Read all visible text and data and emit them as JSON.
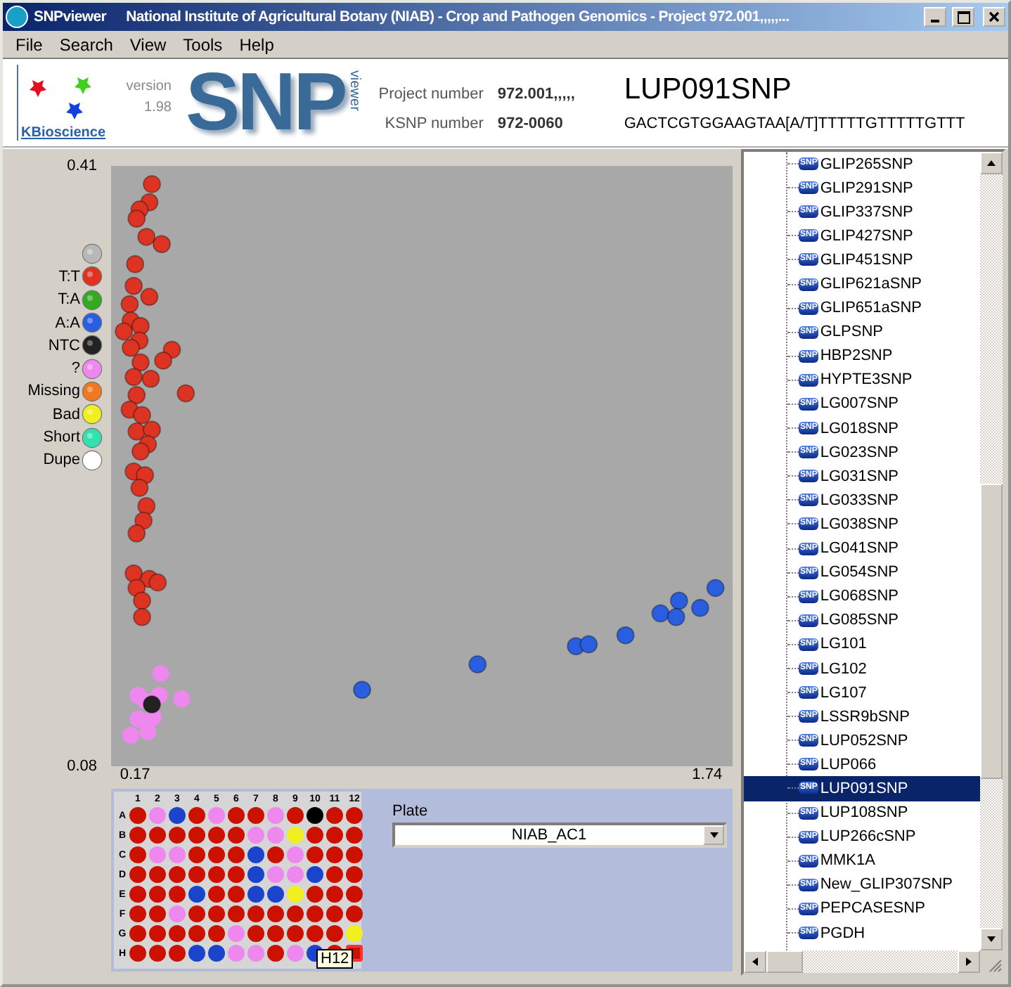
{
  "window": {
    "app_name": "SNPviewer",
    "title": "National Institute of Agricultural Botany (NIAB) - Crop and Pathogen Genomics - Project 972.001,,,,,..."
  },
  "menu": [
    "File",
    "Search",
    "View",
    "Tools",
    "Help"
  ],
  "header": {
    "company": "KBioscience",
    "version_label": "version",
    "version": "1.98",
    "logo_text": "SNP",
    "logo_sub": "viewer",
    "project_label": "Project number",
    "project_value": "972.001,,,,,",
    "ksnp_label": "KSNP number",
    "ksnp_value": "972-0060",
    "snp_name": "LUP091SNP",
    "sequence": "GACTCGTGGAAGTAA[A/T]TTTTTGTTTTTGTTT"
  },
  "legend": [
    {
      "color": "#b8b8b8"
    },
    {
      "label": "T:T",
      "color": "#dd3322"
    },
    {
      "label": "T:A",
      "color": "#33aa22"
    },
    {
      "label": "A:A",
      "color": "#2a5ee0"
    },
    {
      "label": "NTC",
      "color": "#222222"
    },
    {
      "label": "?",
      "color": "#ee88ee"
    },
    {
      "label": "Missing",
      "color": "#f07820"
    },
    {
      "label": "Bad",
      "color": "#f0f020"
    },
    {
      "label": "Short",
      "color": "#33e0b0"
    },
    {
      "label": "Dupe",
      "color": "#ffffff"
    }
  ],
  "plot": {
    "chart_data": {
      "type": "scatter",
      "xlim": [
        0.104,
        1.81
      ],
      "ylim": [
        0.08,
        0.41
      ],
      "xticks": [
        {
          "value": 0.17,
          "label": "0.17"
        },
        {
          "value": 1.74,
          "label": "1.74"
        }
      ],
      "yticks": [
        {
          "value": 0.08,
          "label": "0.08"
        },
        {
          "value": 0.41,
          "label": "0.41"
        }
      ],
      "series": [
        {
          "color": "#dd3322",
          "x": [
            0.216,
            0.209,
            0.182,
            0.174,
            0.201,
            0.243,
            0.17,
            0.166,
            0.209,
            0.155,
            0.158,
            0.185,
            0.139,
            0.182,
            0.271,
            0.247,
            0.158,
            0.185,
            0.166,
            0.213,
            0.309,
            0.174,
            0.155,
            0.189,
            0.174,
            0.216,
            0.205,
            0.185,
            0.166,
            0.197,
            0.182,
            0.201,
            0.193,
            0.174,
            0.166,
            0.209,
            0.232,
            0.174,
            0.189,
            0.189
          ],
          "values": [
            0.4,
            0.39,
            0.386,
            0.381,
            0.371,
            0.367,
            0.356,
            0.344,
            0.338,
            0.334,
            0.325,
            0.322,
            0.319,
            0.314,
            0.309,
            0.303,
            0.31,
            0.302,
            0.294,
            0.293,
            0.285,
            0.284,
            0.276,
            0.273,
            0.264,
            0.265,
            0.257,
            0.253,
            0.242,
            0.24,
            0.233,
            0.223,
            0.215,
            0.208,
            0.186,
            0.183,
            0.181,
            0.178,
            0.171,
            0.162
          ]
        },
        {
          "color": "#2a5ee0",
          "x": [
            0.793,
            1.11,
            1.38,
            1.415,
            1.516,
            1.612,
            1.663,
            1.655,
            1.721,
            1.763
          ],
          "values": [
            0.122,
            0.136,
            0.146,
            0.147,
            0.152,
            0.164,
            0.171,
            0.162,
            0.167,
            0.178
          ]
        },
        {
          "color": "#ee88ee",
          "x": [
            0.24,
            0.178,
            0.236,
            0.298,
            0.197,
            0.22,
            0.178,
            0.205,
            0.158
          ],
          "values": [
            0.131,
            0.119,
            0.119,
            0.117,
            0.116,
            0.107,
            0.106,
            0.099,
            0.097
          ]
        },
        {
          "color": "#222222",
          "x": [
            0.216
          ],
          "values": [
            0.114
          ]
        }
      ]
    }
  },
  "plate": {
    "columns": [
      "1",
      "2",
      "3",
      "4",
      "5",
      "6",
      "7",
      "8",
      "9",
      "10",
      "11",
      "12"
    ],
    "rows": [
      {
        "label": "A",
        "wells": [
          {
            "color": "#cc1100",
            "selected": false
          },
          {
            "color": "#ee88ee",
            "selected": false
          },
          {
            "color": "#1a44cc",
            "selected": false
          },
          {
            "color": "#cc1100",
            "selected": false
          },
          {
            "color": "#ee88ee",
            "selected": false
          },
          {
            "color": "#cc1100",
            "selected": false
          },
          {
            "color": "#cc1100",
            "selected": false
          },
          {
            "color": "#ee88ee",
            "selected": false
          },
          {
            "color": "#cc1100",
            "selected": false
          },
          {
            "color": "#000000",
            "selected": false
          },
          {
            "color": "#cc1100",
            "selected": false
          },
          {
            "color": "#cc1100",
            "selected": false
          }
        ]
      },
      {
        "label": "B",
        "wells": [
          {
            "color": "#cc1100",
            "selected": false
          },
          {
            "color": "#cc1100",
            "selected": false
          },
          {
            "color": "#cc1100",
            "selected": false
          },
          {
            "color": "#cc1100",
            "selected": false
          },
          {
            "color": "#cc1100",
            "selected": false
          },
          {
            "color": "#cc1100",
            "selected": false
          },
          {
            "color": "#ee88ee",
            "selected": false
          },
          {
            "color": "#ee88ee",
            "selected": false
          },
          {
            "color": "#f0f020",
            "selected": false
          },
          {
            "color": "#cc1100",
            "selected": false
          },
          {
            "color": "#cc1100",
            "selected": false
          },
          {
            "color": "#cc1100",
            "selected": false
          }
        ]
      },
      {
        "label": "C",
        "wells": [
          {
            "color": "#cc1100",
            "selected": false
          },
          {
            "color": "#ee88ee",
            "selected": false
          },
          {
            "color": "#ee88ee",
            "selected": false
          },
          {
            "color": "#cc1100",
            "selected": false
          },
          {
            "color": "#cc1100",
            "selected": false
          },
          {
            "color": "#cc1100",
            "selected": false
          },
          {
            "color": "#1a44cc",
            "selected": false
          },
          {
            "color": "#cc1100",
            "selected": false
          },
          {
            "color": "#ee88ee",
            "selected": false
          },
          {
            "color": "#cc1100",
            "selected": false
          },
          {
            "color": "#cc1100",
            "selected": false
          },
          {
            "color": "#cc1100",
            "selected": false
          }
        ]
      },
      {
        "label": "D",
        "wells": [
          {
            "color": "#cc1100",
            "selected": false
          },
          {
            "color": "#cc1100",
            "selected": false
          },
          {
            "color": "#cc1100",
            "selected": false
          },
          {
            "color": "#cc1100",
            "selected": false
          },
          {
            "color": "#cc1100",
            "selected": false
          },
          {
            "color": "#cc1100",
            "selected": false
          },
          {
            "color": "#1a44cc",
            "selected": false
          },
          {
            "color": "#ee88ee",
            "selected": false
          },
          {
            "color": "#ee88ee",
            "selected": false
          },
          {
            "color": "#1a44cc",
            "selected": false
          },
          {
            "color": "#cc1100",
            "selected": false
          },
          {
            "color": "#cc1100",
            "selected": false
          }
        ]
      },
      {
        "label": "E",
        "wells": [
          {
            "color": "#cc1100",
            "selected": false
          },
          {
            "color": "#cc1100",
            "selected": false
          },
          {
            "color": "#cc1100",
            "selected": false
          },
          {
            "color": "#1a44cc",
            "selected": false
          },
          {
            "color": "#cc1100",
            "selected": false
          },
          {
            "color": "#cc1100",
            "selected": false
          },
          {
            "color": "#1a44cc",
            "selected": false
          },
          {
            "color": "#1a44cc",
            "selected": false
          },
          {
            "color": "#f0f020",
            "selected": false
          },
          {
            "color": "#cc1100",
            "selected": false
          },
          {
            "color": "#cc1100",
            "selected": false
          },
          {
            "color": "#cc1100",
            "selected": false
          }
        ]
      },
      {
        "label": "F",
        "wells": [
          {
            "color": "#cc1100",
            "selected": false
          },
          {
            "color": "#cc1100",
            "selected": false
          },
          {
            "color": "#ee88ee",
            "selected": false
          },
          {
            "color": "#cc1100",
            "selected": false
          },
          {
            "color": "#cc1100",
            "selected": false
          },
          {
            "color": "#cc1100",
            "selected": false
          },
          {
            "color": "#cc1100",
            "selected": false
          },
          {
            "color": "#cc1100",
            "selected": false
          },
          {
            "color": "#cc1100",
            "selected": false
          },
          {
            "color": "#cc1100",
            "selected": false
          },
          {
            "color": "#cc1100",
            "selected": false
          },
          {
            "color": "#cc1100",
            "selected": false
          }
        ]
      },
      {
        "label": "G",
        "wells": [
          {
            "color": "#cc1100",
            "selected": false
          },
          {
            "color": "#cc1100",
            "selected": false
          },
          {
            "color": "#cc1100",
            "selected": false
          },
          {
            "color": "#cc1100",
            "selected": false
          },
          {
            "color": "#cc1100",
            "selected": false
          },
          {
            "color": "#ee88ee",
            "selected": false
          },
          {
            "color": "#cc1100",
            "selected": false
          },
          {
            "color": "#cc1100",
            "selected": false
          },
          {
            "color": "#cc1100",
            "selected": false
          },
          {
            "color": "#cc1100",
            "selected": false
          },
          {
            "color": "#cc1100",
            "selected": false
          },
          {
            "color": "#f0f020",
            "selected": false
          }
        ]
      },
      {
        "label": "H",
        "wells": [
          {
            "color": "#cc1100",
            "selected": false
          },
          {
            "color": "#cc1100",
            "selected": false
          },
          {
            "color": "#cc1100",
            "selected": false
          },
          {
            "color": "#1a44cc",
            "selected": false
          },
          {
            "color": "#1a44cc",
            "selected": false
          },
          {
            "color": "#ee88ee",
            "selected": false
          },
          {
            "color": "#ee88ee",
            "selected": false
          },
          {
            "color": "#cc1100",
            "selected": false
          },
          {
            "color": "#ee88ee",
            "selected": false
          },
          {
            "color": "#1a44cc",
            "selected": false
          },
          {
            "color": "#cc1100",
            "selected": false
          },
          {
            "color": "#cc1100",
            "selected": true
          }
        ]
      }
    ],
    "tooltip": "H12",
    "plate_label": "Plate",
    "plate_value": "NIAB_AC1"
  },
  "snp_list": [
    {
      "badge": "SNP",
      "label": "GLIP265SNP",
      "selected": false
    },
    {
      "badge": "SNP",
      "label": "GLIP291SNP",
      "selected": false
    },
    {
      "badge": "SNP",
      "label": "GLIP337SNP",
      "selected": false
    },
    {
      "badge": "SNP",
      "label": "GLIP427SNP",
      "selected": false
    },
    {
      "badge": "SNP",
      "label": "GLIP451SNP",
      "selected": false
    },
    {
      "badge": "SNP",
      "label": "GLIP621aSNP",
      "selected": false
    },
    {
      "badge": "SNP",
      "label": "GLIP651aSNP",
      "selected": false
    },
    {
      "badge": "SNP",
      "label": "GLPSNP",
      "selected": false
    },
    {
      "badge": "SNP",
      "label": "HBP2SNP",
      "selected": false
    },
    {
      "badge": "SNP",
      "label": "HYPTE3SNP",
      "selected": false
    },
    {
      "badge": "SNP",
      "label": "LG007SNP",
      "selected": false
    },
    {
      "badge": "SNP",
      "label": "LG018SNP",
      "selected": false
    },
    {
      "badge": "SNP",
      "label": "LG023SNP",
      "selected": false
    },
    {
      "badge": "SNP",
      "label": "LG031SNP",
      "selected": false
    },
    {
      "badge": "SNP",
      "label": "LG033SNP",
      "selected": false
    },
    {
      "badge": "SNP",
      "label": "LG038SNP",
      "selected": false
    },
    {
      "badge": "SNP",
      "label": "LG041SNP",
      "selected": false
    },
    {
      "badge": "SNP",
      "label": "LG054SNP",
      "selected": false
    },
    {
      "badge": "SNP",
      "label": "LG068SNP",
      "selected": false
    },
    {
      "badge": "SNP",
      "label": "LG085SNP",
      "selected": false
    },
    {
      "badge": "SNP",
      "label": "LG101",
      "selected": false
    },
    {
      "badge": "SNP",
      "label": "LG102",
      "selected": false
    },
    {
      "badge": "SNP",
      "label": "LG107",
      "selected": false
    },
    {
      "badge": "SNP",
      "label": "LSSR9bSNP",
      "selected": false
    },
    {
      "badge": "SNP",
      "label": "LUP052SNP",
      "selected": false
    },
    {
      "badge": "SNP",
      "label": "LUP066",
      "selected": false
    },
    {
      "badge": "SNP",
      "label": "LUP091SNP",
      "selected": true
    },
    {
      "badge": "SNP",
      "label": "LUP108SNP",
      "selected": false
    },
    {
      "badge": "SNP",
      "label": "LUP266cSNP",
      "selected": false
    },
    {
      "badge": "SNP",
      "label": "MMK1A",
      "selected": false
    },
    {
      "badge": "SNP",
      "label": "New_GLIP307SNP",
      "selected": false
    },
    {
      "badge": "SNP",
      "label": "PEPCASESNP",
      "selected": false
    },
    {
      "badge": "SNP",
      "label": "PGDH",
      "selected": false
    }
  ]
}
